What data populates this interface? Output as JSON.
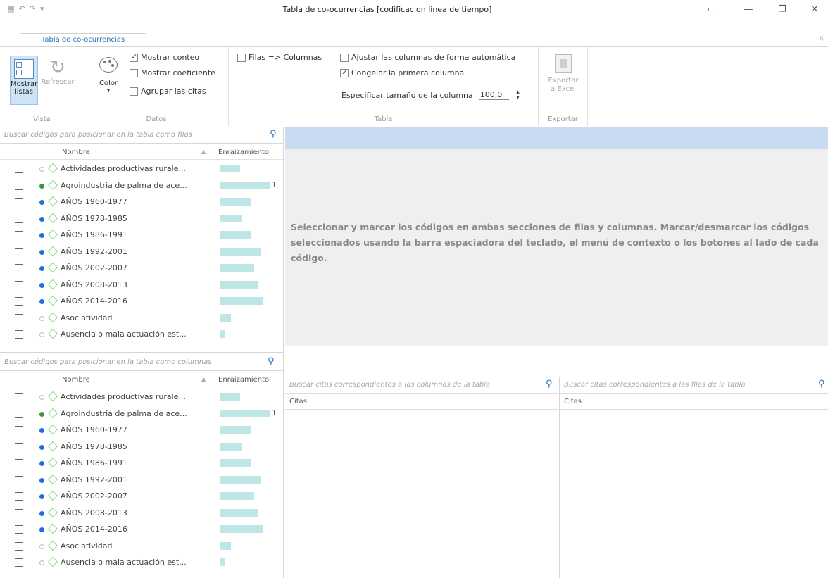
{
  "window": {
    "title": "Tabla de co-ocurrencias [codificacion linea de tiempo]",
    "quick_access": [
      "▦",
      "↶",
      "↷",
      "▾"
    ],
    "edge_mark": "4"
  },
  "ribbon": {
    "tab": "Tabla de co-ocurrencias",
    "groups": {
      "vista": {
        "label": "Vista",
        "mostrar_listas": "Mostrar\nlistas",
        "refrescar": "Refrescar"
      },
      "datos": {
        "label": "Datos",
        "color": "Color",
        "mostrar_conteo": "Mostrar conteo",
        "mostrar_coeficiente": "Mostrar coeficiente",
        "agrupar_citas": "Agrupar las citas"
      },
      "tabla": {
        "label": "Tabla",
        "filas_columnas": "Filas => Columnas",
        "ajustar": "Ajustar las columnas de forma automática",
        "congelar": "Congelar la primera columna",
        "especificar": "Especificar tamaño de la columna",
        "tamano": "100,0"
      },
      "exportar": {
        "label": "Exportar",
        "exportar_excel": "Exportar\na Excel"
      }
    }
  },
  "rows_panel": {
    "search_placeholder": "Buscar códigos para posicionar en la tabla como filas",
    "col_name": "Nombre",
    "col_root": "Enraizamiento"
  },
  "cols_panel": {
    "search_placeholder": "Buscar códigos para posicionar en la tabla como columnas",
    "col_name": "Nombre",
    "col_root": "Enraizamiento"
  },
  "codes": [
    {
      "name": "Actividades productivas rurale...",
      "dot": "hollow",
      "bar": 0.4,
      "count": ""
    },
    {
      "name": "Agroindustria de palma de ace...",
      "dot": "#3a9a3a",
      "bar": 1.0,
      "count": "1"
    },
    {
      "name": "AÑOS 1960-1977",
      "dot": "#1f6fd6",
      "bar": 0.63,
      "count": ""
    },
    {
      "name": "AÑOS 1978-1985",
      "dot": "#1f6fd6",
      "bar": 0.45,
      "count": ""
    },
    {
      "name": "AÑOS 1986-1991",
      "dot": "#1f6fd6",
      "bar": 0.63,
      "count": ""
    },
    {
      "name": "AÑOS 1992-2001",
      "dot": "#1f6fd6",
      "bar": 0.8,
      "count": ""
    },
    {
      "name": "AÑOS 2002-2007",
      "dot": "#1f6fd6",
      "bar": 0.68,
      "count": ""
    },
    {
      "name": "AÑOS 2008-2013",
      "dot": "#1f6fd6",
      "bar": 0.75,
      "count": ""
    },
    {
      "name": "AÑOS 2014-2016",
      "dot": "#1f6fd6",
      "bar": 0.85,
      "count": ""
    },
    {
      "name": "Asociatividad",
      "dot": "hollow",
      "bar": 0.22,
      "count": ""
    },
    {
      "name": "Ausencia o mala actuación est...",
      "dot": "hollow",
      "bar": 0.1,
      "count": ""
    }
  ],
  "message": "Seleccionar y marcar los códigos en ambas secciones de filas y columnas. Marcar/desmarcar los códigos seleccionados usando la barra espaciadora del teclado, el menú de contexto o los botones al lado de cada código.",
  "cites": {
    "left_placeholder": "Buscar citas correspondientes a las columnas de la tabla",
    "right_placeholder": "Buscar citas correspondientes a las filas de la tabla",
    "left_header": "Citas",
    "right_header": "Citas"
  }
}
